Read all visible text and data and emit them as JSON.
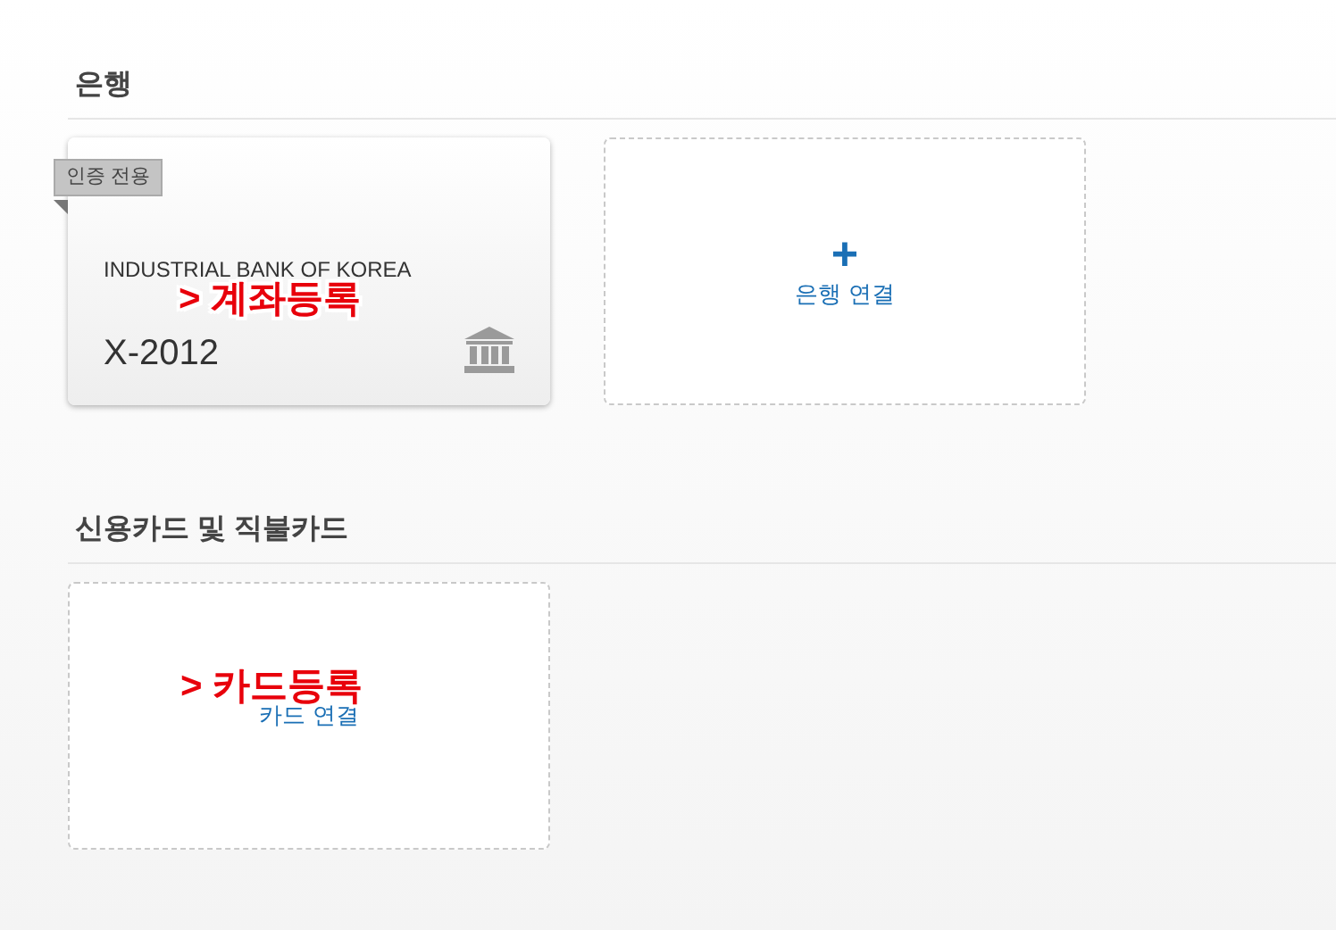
{
  "sections": [
    {
      "title": "은행",
      "accounts": [
        {
          "badge": "인증 전용",
          "bank": "INDUSTRIAL BANK OF KOREA",
          "number": "X-2012",
          "annotation": "> 계좌등록"
        }
      ],
      "add": {
        "symbol": "+",
        "label": "은행 연결"
      }
    },
    {
      "title": "신용카드 및 직불카드",
      "add": {
        "label": "카드 연결",
        "annotation": "> 카드등록"
      }
    }
  ]
}
